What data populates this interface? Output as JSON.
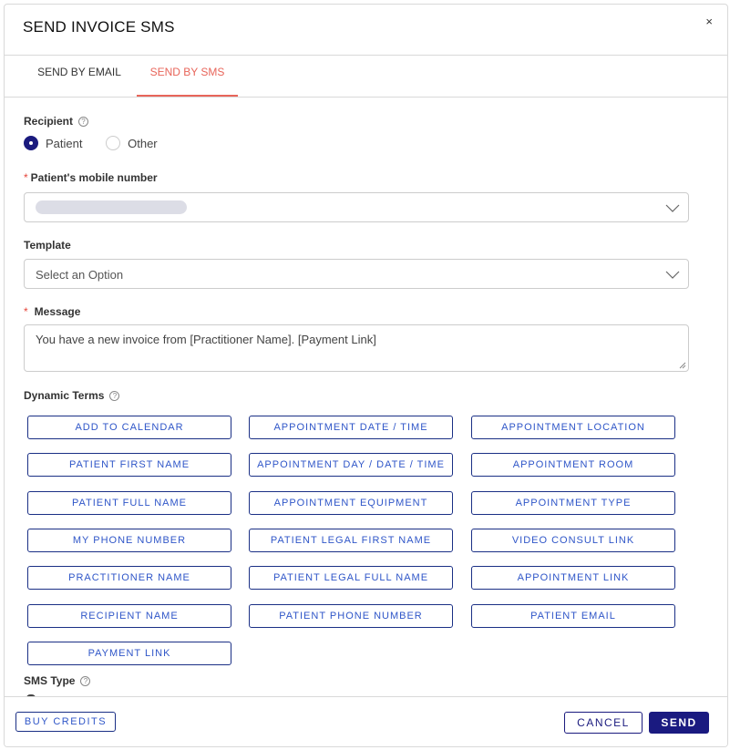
{
  "dialog": {
    "title": "SEND INVOICE SMS",
    "close_glyph": "×"
  },
  "tabs": [
    {
      "label": "SEND BY EMAIL",
      "active": false
    },
    {
      "label": "SEND BY SMS",
      "active": true
    }
  ],
  "recipient": {
    "label": "Recipient",
    "options": [
      {
        "label": "Patient",
        "selected": true
      },
      {
        "label": "Other",
        "selected": false
      }
    ]
  },
  "mobile": {
    "required_mark": "*",
    "label": "Patient's mobile number",
    "value_redacted": true
  },
  "template": {
    "label": "Template",
    "placeholder": "Select an Option"
  },
  "message": {
    "required_mark": "*",
    "label": "Message",
    "value": "You have a new invoice from [Practitioner Name]. [Payment Link]"
  },
  "dynamic_terms": {
    "label": "Dynamic Terms",
    "items": [
      "ADD TO CALENDAR",
      "APPOINTMENT DATE / TIME",
      "APPOINTMENT LOCATION",
      "PATIENT FIRST NAME",
      "APPOINTMENT DAY / DATE / TIME",
      "APPOINTMENT ROOM",
      "PATIENT FULL NAME",
      "APPOINTMENT EQUIPMENT",
      "APPOINTMENT TYPE",
      "MY PHONE NUMBER",
      "PATIENT LEGAL FIRST NAME",
      "VIDEO CONSULT LINK",
      "PRACTITIONER NAME",
      "PATIENT LEGAL FULL NAME",
      "APPOINTMENT LINK",
      "RECIPIENT NAME",
      "PATIENT PHONE NUMBER",
      "PATIENT EMAIL",
      "PAYMENT LINK"
    ]
  },
  "sms_type": {
    "label": "SMS Type"
  },
  "footer": {
    "buy_credits": "BUY CREDITS",
    "cancel": "CANCEL",
    "send": "SEND"
  },
  "colors": {
    "accent_tab": "#e8655a",
    "primary": "#1a1a80",
    "link_blue": "#2f56c8",
    "required": "#e5463b"
  }
}
